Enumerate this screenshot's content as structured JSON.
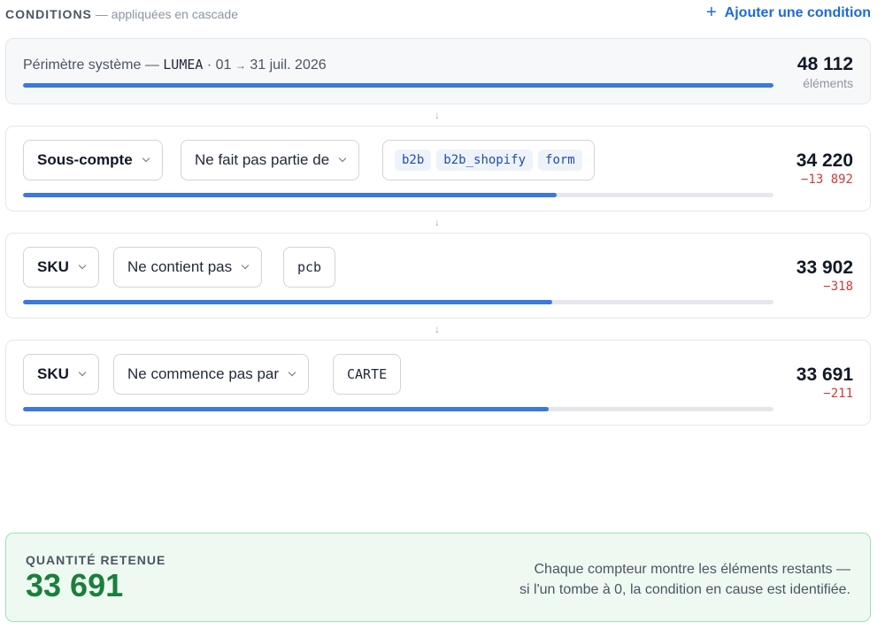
{
  "header": {
    "title": "CONDITIONS",
    "subtitle": "— appliquées en cascade",
    "add_button": "Ajouter une condition"
  },
  "system": {
    "label_prefix": "Périmètre système —",
    "account": "LUMEA",
    "sep": "·",
    "date_start": "01",
    "arrow": "→",
    "date_end": "31 juil. 2026",
    "count": "48 112",
    "count_unit": "éléments",
    "progress": 1.0
  },
  "connector_glyph": "↓",
  "conditions": [
    {
      "field": "Sous-compte",
      "operator": "Ne fait pas partie de",
      "values": [
        "b2b",
        "b2b_shopify",
        "form"
      ],
      "count": "34 220",
      "delta": "−13 892",
      "progress": 0.7113
    },
    {
      "field": "SKU",
      "operator": "Ne contient pas",
      "values": [
        "pcb"
      ],
      "count": "33 902",
      "delta": "−318",
      "progress": 0.7046
    },
    {
      "field": "SKU",
      "operator": "Ne commence pas par",
      "values": [
        "CARTE"
      ],
      "count": "33 691",
      "delta": "−211",
      "progress": 0.7003
    }
  ],
  "summary": {
    "label": "QUANTITÉ RETENUE",
    "value": "33 691",
    "note_line1": "Chaque compteur montre les éléments restants —",
    "note_line2": "si l'un tombe à 0, la condition en cause est identifiée."
  },
  "colors": {
    "accent": "#1d6ad8",
    "bar": "#3b78e0",
    "delta": "#d33a3a",
    "success": "#1a7f3c"
  }
}
